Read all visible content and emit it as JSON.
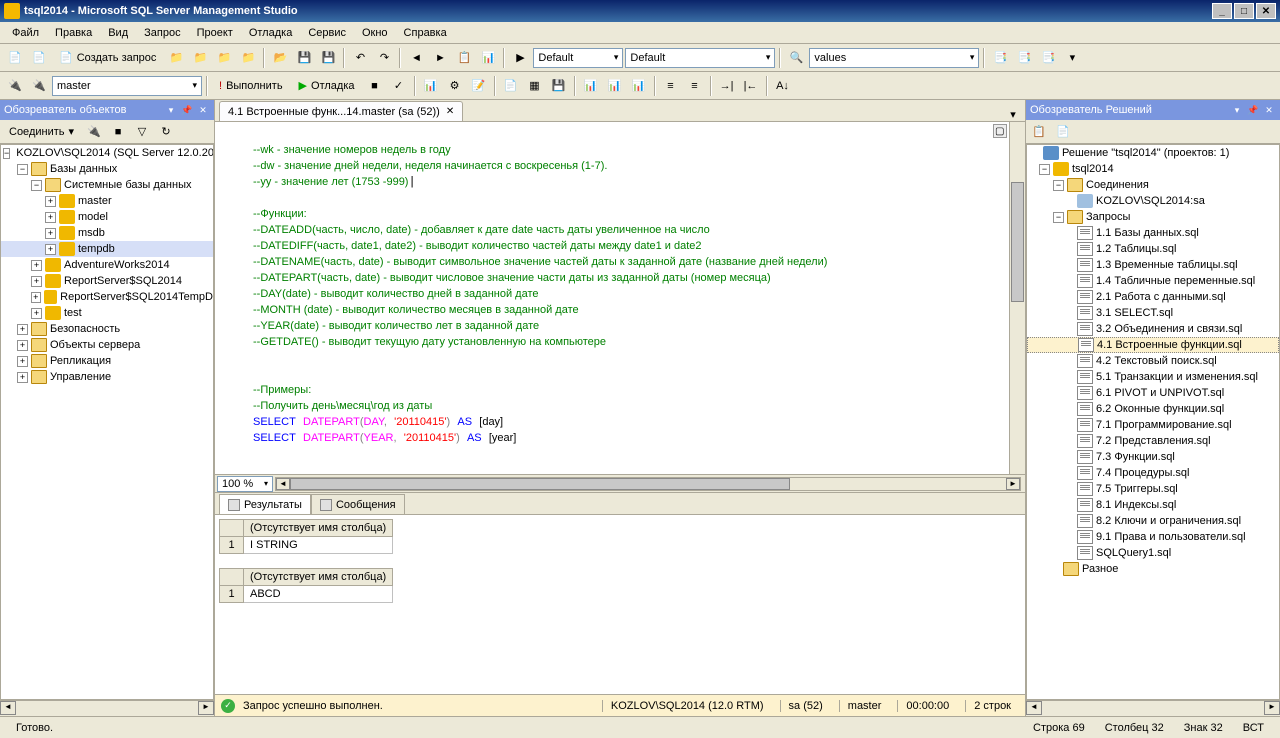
{
  "title": "tsql2014 - Microsoft SQL Server Management Studio",
  "menu": [
    "Файл",
    "Правка",
    "Вид",
    "Запрос",
    "Проект",
    "Отладка",
    "Сервис",
    "Окно",
    "Справка"
  ],
  "tb1": {
    "newquery": "Создать запрос",
    "combo1": "Default",
    "combo2": "Default",
    "combo3": "values"
  },
  "tb2": {
    "dbcombo": "master",
    "execute": "Выполнить",
    "debug": "Отладка"
  },
  "oe": {
    "header": "Обозреватель объектов",
    "connect": "Соединить",
    "server": "KOZLOV\\SQL2014 (SQL Server 12.0.20",
    "databases": "Базы данных",
    "sysdb": "Системные базы данных",
    "dblist": [
      "master",
      "model",
      "msdb",
      "tempdb"
    ],
    "userdb": [
      "AdventureWorks2014",
      "ReportServer$SQL2014",
      "ReportServer$SQL2014TempD",
      "test"
    ],
    "folders": [
      "Безопасность",
      "Объекты сервера",
      "Репликация",
      "Управление"
    ]
  },
  "se": {
    "header": "Обозреватель Решений",
    "solution": "Решение \"tsql2014\" (проектов: 1)",
    "project": "tsql2014",
    "connections": "Соединения",
    "conn": "KOZLOV\\SQL2014:sa",
    "queries": "Запросы",
    "files": [
      "1.1 Базы данных.sql",
      "1.2 Таблицы.sql",
      "1.3 Временные таблицы.sql",
      "1.4 Табличные переменные.sql",
      "2.1 Работа с данными.sql",
      "3.1 SELECT.sql",
      "3.2 Объединения и связи.sql",
      "4.1 Встроенные функции.sql",
      "4.2 Текстовый поиск.sql",
      "5.1 Транзакции и изменения.sql",
      "6.1 PIVOT и UNPIVOT.sql",
      "6.2 Оконные функции.sql",
      "7.1 Программирование.sql",
      "7.2 Представления.sql",
      "7.3 Функции.sql",
      "7.4 Процедуры.sql",
      "7.5 Триггеры.sql",
      "8.1 Индексы.sql",
      "8.2 Ключи и ограничения.sql",
      "9.1 Права и пользователи.sql",
      "SQLQuery1.sql"
    ],
    "misc": "Разное"
  },
  "doctab": "4.1 Встроенные функ...14.master (sa (52))",
  "editor": {
    "c1": "--wk - значение номеров недель в году",
    "c2": "--dw - значение дней недели, неделя начинается с воскресенья (1-7).",
    "c3": "--yy - значение лет (1753 -999)",
    "c4": "--Функции:",
    "c5": "--DATEADD(часть, число, date) - добавляет к дате date часть даты увеличенное на число",
    "c6": "--DATEDIFF(часть, date1, date2) - выводит количество частей даты между date1 и date2",
    "c7": "--DATENAME(часть, date) - выводит символьное значение частей даты к заданной дате (название дней недели)",
    "c8": "--DATEPART(часть, date) - выводит числовое значение части даты из заданной даты (номер месяца)",
    "c9": "--DAY(date) - выводит количество дней в заданной дате",
    "c10": "--MONTH (date) - выводит количество месяцев в заданной дате",
    "c11": "--YEAR(date) - выводит количество лет в заданной дате",
    "c12": "--GETDATE() - выводит текущую дату установленную на компьютере",
    "c13": "--Примеры:",
    "c14": "--Получить день\\месяц\\год из даты",
    "sel": "SELECT",
    "dp": "DATEPART",
    "day": "DAY",
    "year": "YEAR",
    "d1": "'20110415'",
    "as": "AS",
    "al1": "[day]",
    "al2": "[year]"
  },
  "zoom": "100 %",
  "restabs": {
    "results": "Результаты",
    "messages": "Сообщения"
  },
  "grid": {
    "nocol": "(Отсутствует имя столбца)",
    "v1": "I STRING",
    "v2": "ABCD"
  },
  "qstatus": {
    "msg": "Запрос успешно выполнен.",
    "server": "KOZLOV\\SQL2014 (12.0 RTM)",
    "login": "sa (52)",
    "db": "master",
    "time": "00:00:00",
    "rows": "2 строк"
  },
  "status": {
    "ready": "Готово.",
    "line": "Строка 69",
    "col": "Столбец 32",
    "char": "Знак 32",
    "ins": "ВСТ"
  }
}
